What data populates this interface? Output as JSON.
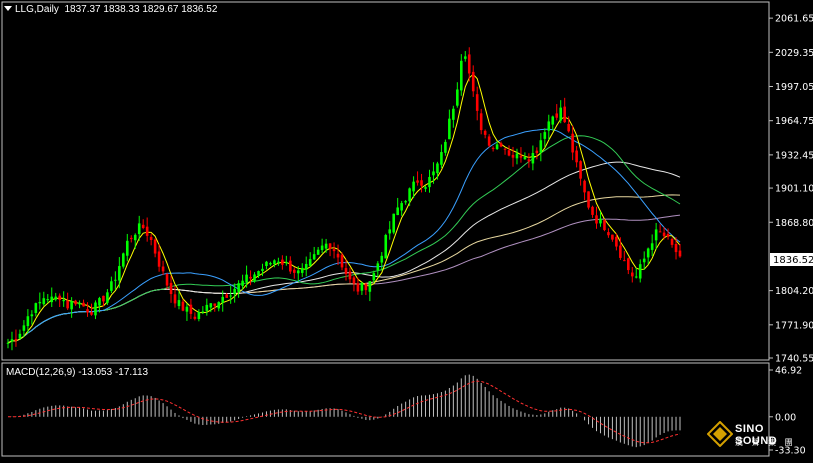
{
  "header": {
    "symbol": "LLG,Daily",
    "ohlc": "1837.37 1838.33 1829.67 1836.52"
  },
  "macd_header": {
    "label": "MACD(12,26,9) -13.053 -17.113"
  },
  "price_axis": {
    "ticks": [
      "2061.65",
      "2029.35",
      "1997.05",
      "1964.75",
      "1932.45",
      "1901.10",
      "1868.80",
      "1836.52",
      "1804.20",
      "1771.90",
      "1740.55"
    ],
    "current": "1836.52"
  },
  "macd_axis": {
    "ticks": [
      "46.92",
      "0.00",
      "-33.30"
    ]
  },
  "logo": {
    "name": "SINO SOUND",
    "sub": "漢 聲 集 團"
  },
  "colors": {
    "background": "#000000",
    "bull": "#00ff00",
    "bear": "#ff0000",
    "ma_yellow": "#ffff00",
    "ma_blue": "#3aa0ff",
    "ma_green": "#33cc55",
    "ma_white": "#e8e8e8",
    "ma_beige": "#e8d8a0",
    "ma_purple": "#b090c0",
    "macd_hist": "#c0c0c0",
    "macd_signal": "#ff3030"
  },
  "chart_data": {
    "type": "candlestick",
    "symbol": "LLG",
    "timeframe": "Daily",
    "ylim": [
      1740.55,
      2075
    ],
    "approx_close_path": [
      1755,
      1760,
      1770,
      1785,
      1790,
      1800,
      1795,
      1800,
      1790,
      1795,
      1790,
      1785,
      1790,
      1800,
      1810,
      1830,
      1850,
      1860,
      1865,
      1855,
      1835,
      1815,
      1800,
      1790,
      1785,
      1780,
      1785,
      1790,
      1795,
      1800,
      1805,
      1810,
      1815,
      1820,
      1825,
      1830,
      1835,
      1830,
      1825,
      1820,
      1825,
      1835,
      1845,
      1850,
      1840,
      1825,
      1810,
      1805,
      1810,
      1820,
      1840,
      1860,
      1880,
      1890,
      1900,
      1910,
      1905,
      1915,
      1930,
      1960,
      1990,
      2040,
      2000,
      1965,
      1950,
      1940,
      1945,
      1935,
      1930,
      1935,
      1930,
      1940,
      1960,
      1970,
      1975,
      1955,
      1925,
      1900,
      1880,
      1870,
      1865,
      1855,
      1840,
      1825,
      1815,
      1830,
      1850,
      1860,
      1855,
      1845,
      1836.52
    ],
    "last_close": 1836.52,
    "indicators": {
      "macd": {
        "params": "12,26,9",
        "main": -13.053,
        "signal": -17.113,
        "ylim": [
          -33.3,
          46.92
        ]
      }
    }
  }
}
